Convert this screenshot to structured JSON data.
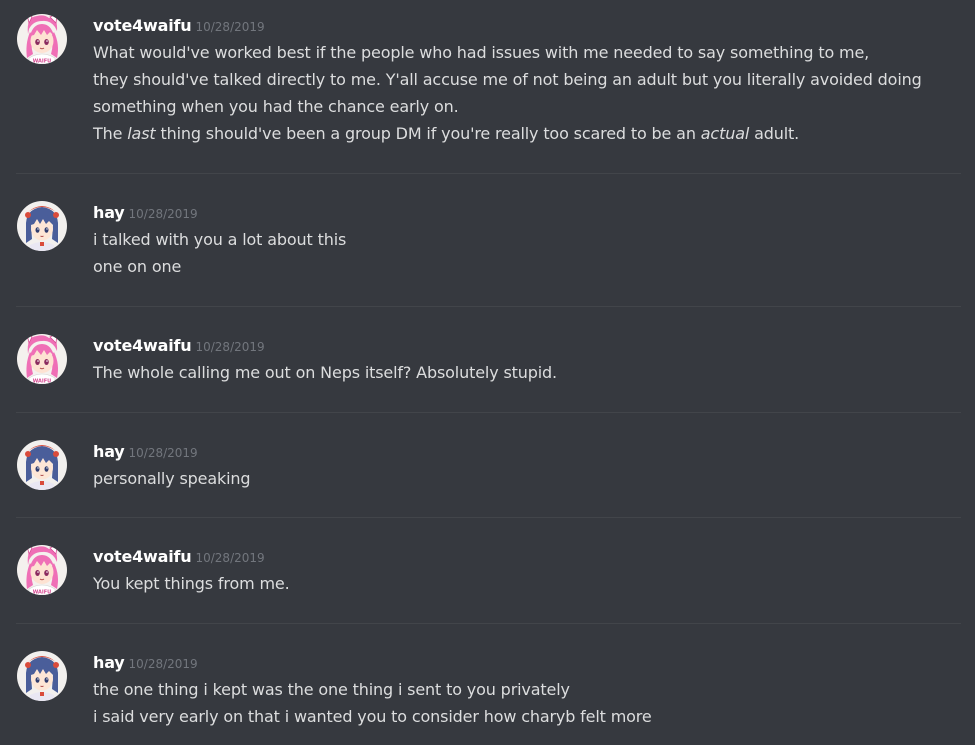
{
  "colors": {
    "background": "#36393f",
    "text": "#dcddde",
    "username": "#ffffff",
    "timestamp": "#72767d",
    "divider": "#42454a"
  },
  "messages": [
    {
      "author": "vote4waifu",
      "avatar_icon": "pink-hair-anime-avatar-icon",
      "timestamp": "10/28/2019",
      "lines": [
        {
          "plain": "What would've worked best if the people who had issues with me needed to say something to me,"
        },
        {
          "plain": "they should've talked directly to me. Y'all accuse me of not being an adult but you literally avoided doing"
        },
        {
          "plain": "something when you had the chance early on."
        },
        {
          "p1": "The ",
          "e1": "last",
          "p2": " thing should've been a group DM if you're really too scared to be an ",
          "e2": "actual",
          "p3": " adult."
        }
      ]
    },
    {
      "author": "hay",
      "avatar_icon": "blue-hair-anime-avatar-icon",
      "timestamp": "10/28/2019",
      "lines": [
        {
          "plain": "i talked with you a lot about this"
        },
        {
          "plain": "one on one"
        }
      ]
    },
    {
      "author": "vote4waifu",
      "avatar_icon": "pink-hair-anime-avatar-icon",
      "timestamp": "10/28/2019",
      "lines": [
        {
          "plain": "The whole calling me out on Neps itself? Absolutely stupid."
        }
      ]
    },
    {
      "author": "hay",
      "avatar_icon": "blue-hair-anime-avatar-icon",
      "timestamp": "10/28/2019",
      "lines": [
        {
          "plain": "personally speaking"
        }
      ]
    },
    {
      "author": "vote4waifu",
      "avatar_icon": "pink-hair-anime-avatar-icon",
      "timestamp": "10/28/2019",
      "lines": [
        {
          "plain": "You kept things from me."
        }
      ]
    },
    {
      "author": "hay",
      "avatar_icon": "blue-hair-anime-avatar-icon",
      "timestamp": "10/28/2019",
      "lines": [
        {
          "plain": "the one thing i kept was the one thing i sent to you privately"
        },
        {
          "plain": "i said very early on that i wanted you to consider how charyb felt more"
        }
      ]
    }
  ]
}
